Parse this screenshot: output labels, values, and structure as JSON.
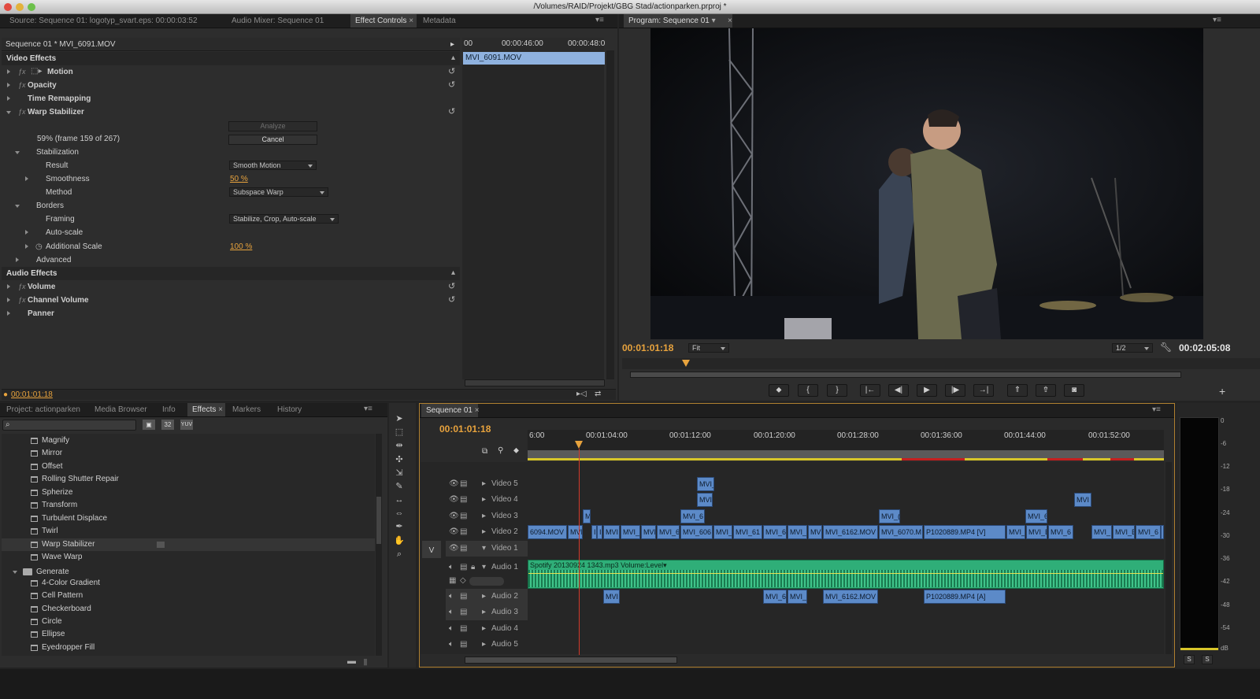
{
  "window": {
    "title": "/Volumes/RAID/Projekt/GBG Stad/actionparken.prproj *"
  },
  "top_tabs": {
    "source": "Source: Sequence 01: logotyp_svart.eps: 00:00:03:52",
    "audio_mixer": "Audio Mixer: Sequence 01",
    "effect_controls": "Effect Controls",
    "metadata": "Metadata"
  },
  "effect_controls": {
    "clip_path": "Sequence 01 * MVI_6091.MOV",
    "clip_name": "MVI_6091.MOV",
    "ruler": [
      "00",
      "00:00:46:00",
      "00:00:48:0"
    ],
    "video_effects": "Video Effects",
    "motion": "Motion",
    "opacity": "Opacity",
    "time_remapping": "Time Remapping",
    "warp_stabilizer": "Warp Stabilizer",
    "analyze": "Analyze",
    "progress": "59% (frame 159 of 267)",
    "cancel": "Cancel",
    "stabilization": "Stabilization",
    "result": "Result",
    "result_value": "Smooth Motion",
    "smoothness": "Smoothness",
    "smoothness_value": "50 %",
    "method": "Method",
    "method_value": "Subspace Warp",
    "borders": "Borders",
    "framing": "Framing",
    "framing_value": "Stabilize, Crop, Auto-scale",
    "auto_scale": "Auto-scale",
    "additional_scale": "Additional Scale",
    "additional_scale_value": "100 %",
    "advanced": "Advanced",
    "audio_effects": "Audio Effects",
    "volume": "Volume",
    "channel_volume": "Channel Volume",
    "panner": "Panner",
    "timecode": "00:01:01:18"
  },
  "program": {
    "tab": "Program: Sequence 01",
    "timecode": "00:01:01:18",
    "fit": "Fit",
    "resolution": "1/2",
    "duration": "00:02:05:08"
  },
  "project_tabs": {
    "project": "Project: actionparken",
    "media_browser": "Media Browser",
    "info": "Info",
    "effects": "Effects",
    "markers": "Markers",
    "history": "History"
  },
  "effects_list": {
    "items": [
      "Magnify",
      "Mirror",
      "Offset",
      "Rolling Shutter Repair",
      "Spherize",
      "Transform",
      "Turbulent Displace",
      "Twirl",
      "Warp Stabilizer",
      "Wave Warp"
    ],
    "folder": "Generate",
    "gen_items": [
      "4-Color Gradient",
      "Cell Pattern",
      "Checkerboard",
      "Circle",
      "Ellipse",
      "Eyedropper Fill"
    ],
    "icon_32": "32",
    "icon_yuv": "YUV"
  },
  "timeline": {
    "tab": "Sequence 01",
    "timecode": "00:01:01:18",
    "ruler": [
      "6:00",
      "00:01:04:00",
      "00:01:12:00",
      "00:01:20:00",
      "00:01:28:00",
      "00:01:36:00",
      "00:01:44:00",
      "00:01:52:00"
    ],
    "tracks": [
      "Video 5",
      "Video 4",
      "Video 3",
      "Video 2",
      "Video 1",
      "Audio 1",
      "Audio 2",
      "Audio 3",
      "Audio 4",
      "Audio 5"
    ],
    "v_label": "V",
    "audio_clip": "Spotify 20130924 1343.mp3",
    "volume_level": "Volume:Level",
    "clips_v5": [
      "MVI_"
    ],
    "clips_v4": [
      "MVI",
      "MVI"
    ],
    "clips_v3": [
      "M",
      "MVI_6",
      "MVI_(",
      "MVI_6"
    ],
    "clips_v2": [
      "6094.MOV",
      "MVI",
      "I",
      "I",
      "MVI",
      "MVI_",
      "MVI",
      "MVI_6",
      "MVI_606",
      "MVI_",
      "MVI_61",
      "MVI_6",
      "MVI_",
      "MV",
      "MVI_6162.MOV",
      "MVI_6070.M",
      "P1020889.MP4 [V]",
      "MVI_",
      "MVI_E",
      "MVI_6",
      "MVI_",
      "MVI_E",
      "MVI_6",
      "I"
    ],
    "clips_a2": [
      "MVI",
      "MVI_6",
      "MVI_",
      "MVI_6162.MOV",
      "P1020889.MP4 [A]"
    ]
  },
  "meter": {
    "scale": [
      "0",
      "-6",
      "-12",
      "-18",
      "-24",
      "-30",
      "-36",
      "-42",
      "-48",
      "-54",
      "dB"
    ],
    "solo": [
      "S",
      "S"
    ]
  },
  "colors": {
    "accent_timecode": "#e8a33d",
    "clip_blue": "#5c8ac8",
    "audio_green": "#3fbf86",
    "playhead": "#d23a2a"
  }
}
